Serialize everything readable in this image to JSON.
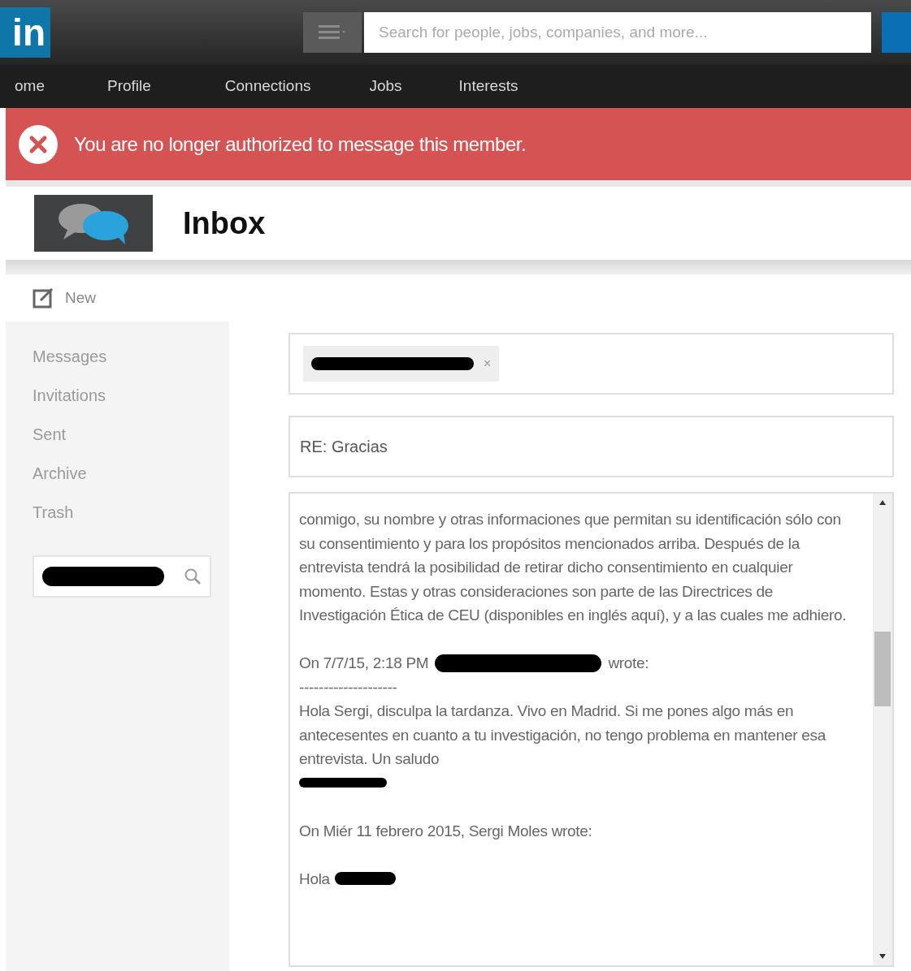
{
  "header": {
    "logo": "in",
    "search": {
      "placeholder": "Search for people, jobs, companies, and more..."
    }
  },
  "nav": [
    {
      "label": "ome"
    },
    {
      "label": "Profile"
    },
    {
      "label": "Connections"
    },
    {
      "label": "Jobs"
    },
    {
      "label": "Interests"
    }
  ],
  "alert": {
    "message": "You are no longer authorized to message this member."
  },
  "page_title": "Inbox",
  "sidebar": {
    "new_button": "New",
    "items": [
      {
        "label": "Messages"
      },
      {
        "label": "Invitations"
      },
      {
        "label": "Sent"
      },
      {
        "label": "Archive"
      },
      {
        "label": "Trash"
      }
    ]
  },
  "compose": {
    "recipient_remove": "×",
    "subject": "RE: Gracias",
    "body": [
      {
        "kind": "para",
        "text": "conmigo, su nombre y otras informaciones que permitan su identificación  sólo con su consentimiento y para los propósitos mencionados arriba. Después de la entrevista tendrá la posibilidad de retirar dicho consentimiento en cualquier momento. Estas y otras consideraciones son parte de las Directrices de Investigación Ética de CEU (disponibles en inglés aquí), y a las cuales me adhiero."
      },
      {
        "kind": "gap"
      },
      {
        "kind": "quote_head",
        "before": "On 7/7/15, 2:18 PM",
        "after": "wrote:"
      },
      {
        "kind": "para",
        "text": "--------------------"
      },
      {
        "kind": "para",
        "text": "Hola Sergi, disculpa la tardanza. Vivo en Madrid. Si me pones algo más en antecesentes en cuanto a tu investigación, no tengo problema en mantener esa entrevista. Un saludo"
      },
      {
        "kind": "redacted"
      },
      {
        "kind": "gap"
      },
      {
        "kind": "para",
        "text": "On Miér 11 febrero 2015, Sergi Moles wrote:"
      },
      {
        "kind": "gap"
      },
      {
        "kind": "greeting",
        "text": "Hola"
      }
    ]
  }
}
